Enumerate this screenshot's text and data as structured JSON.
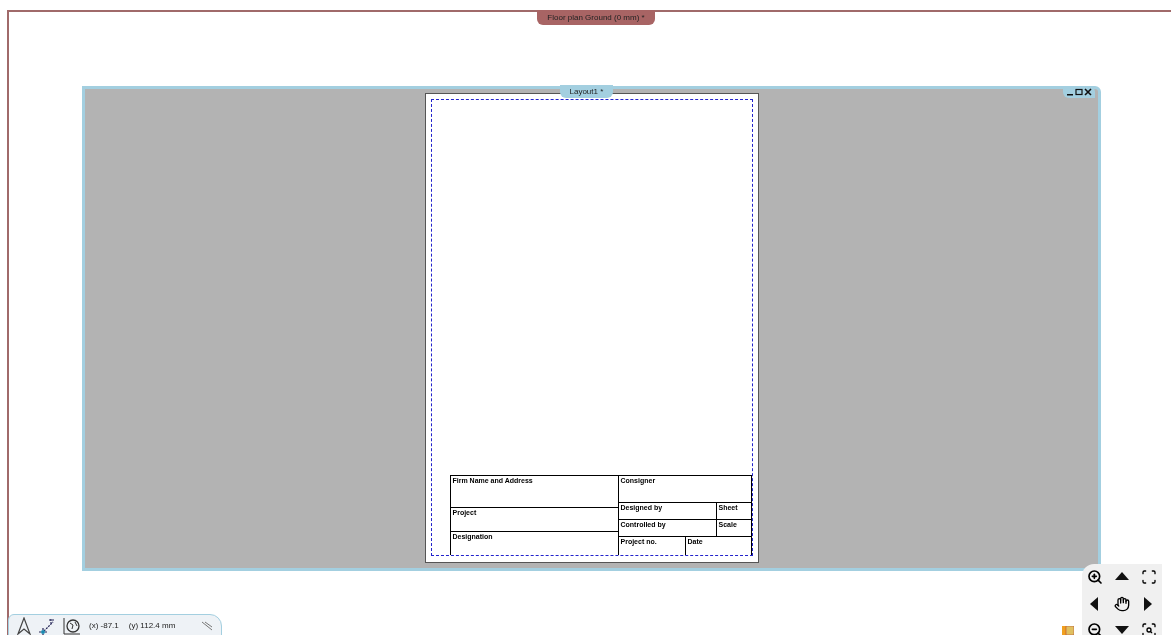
{
  "document_window": {
    "title": "Floor plan Ground (0 mm) *"
  },
  "layout_window": {
    "title": "Layout1 *"
  },
  "title_block": {
    "left": [
      "Firm Name and Address",
      "Project",
      "Designation"
    ],
    "right": [
      "Consigner",
      "Designed by",
      "Sheet",
      "Controlled by",
      "Scale",
      "Project no.",
      "Date"
    ]
  },
  "status_bar": {
    "x_coordinate": "(x) -87.1",
    "y_coordinate": "(y) 112.4 mm"
  }
}
